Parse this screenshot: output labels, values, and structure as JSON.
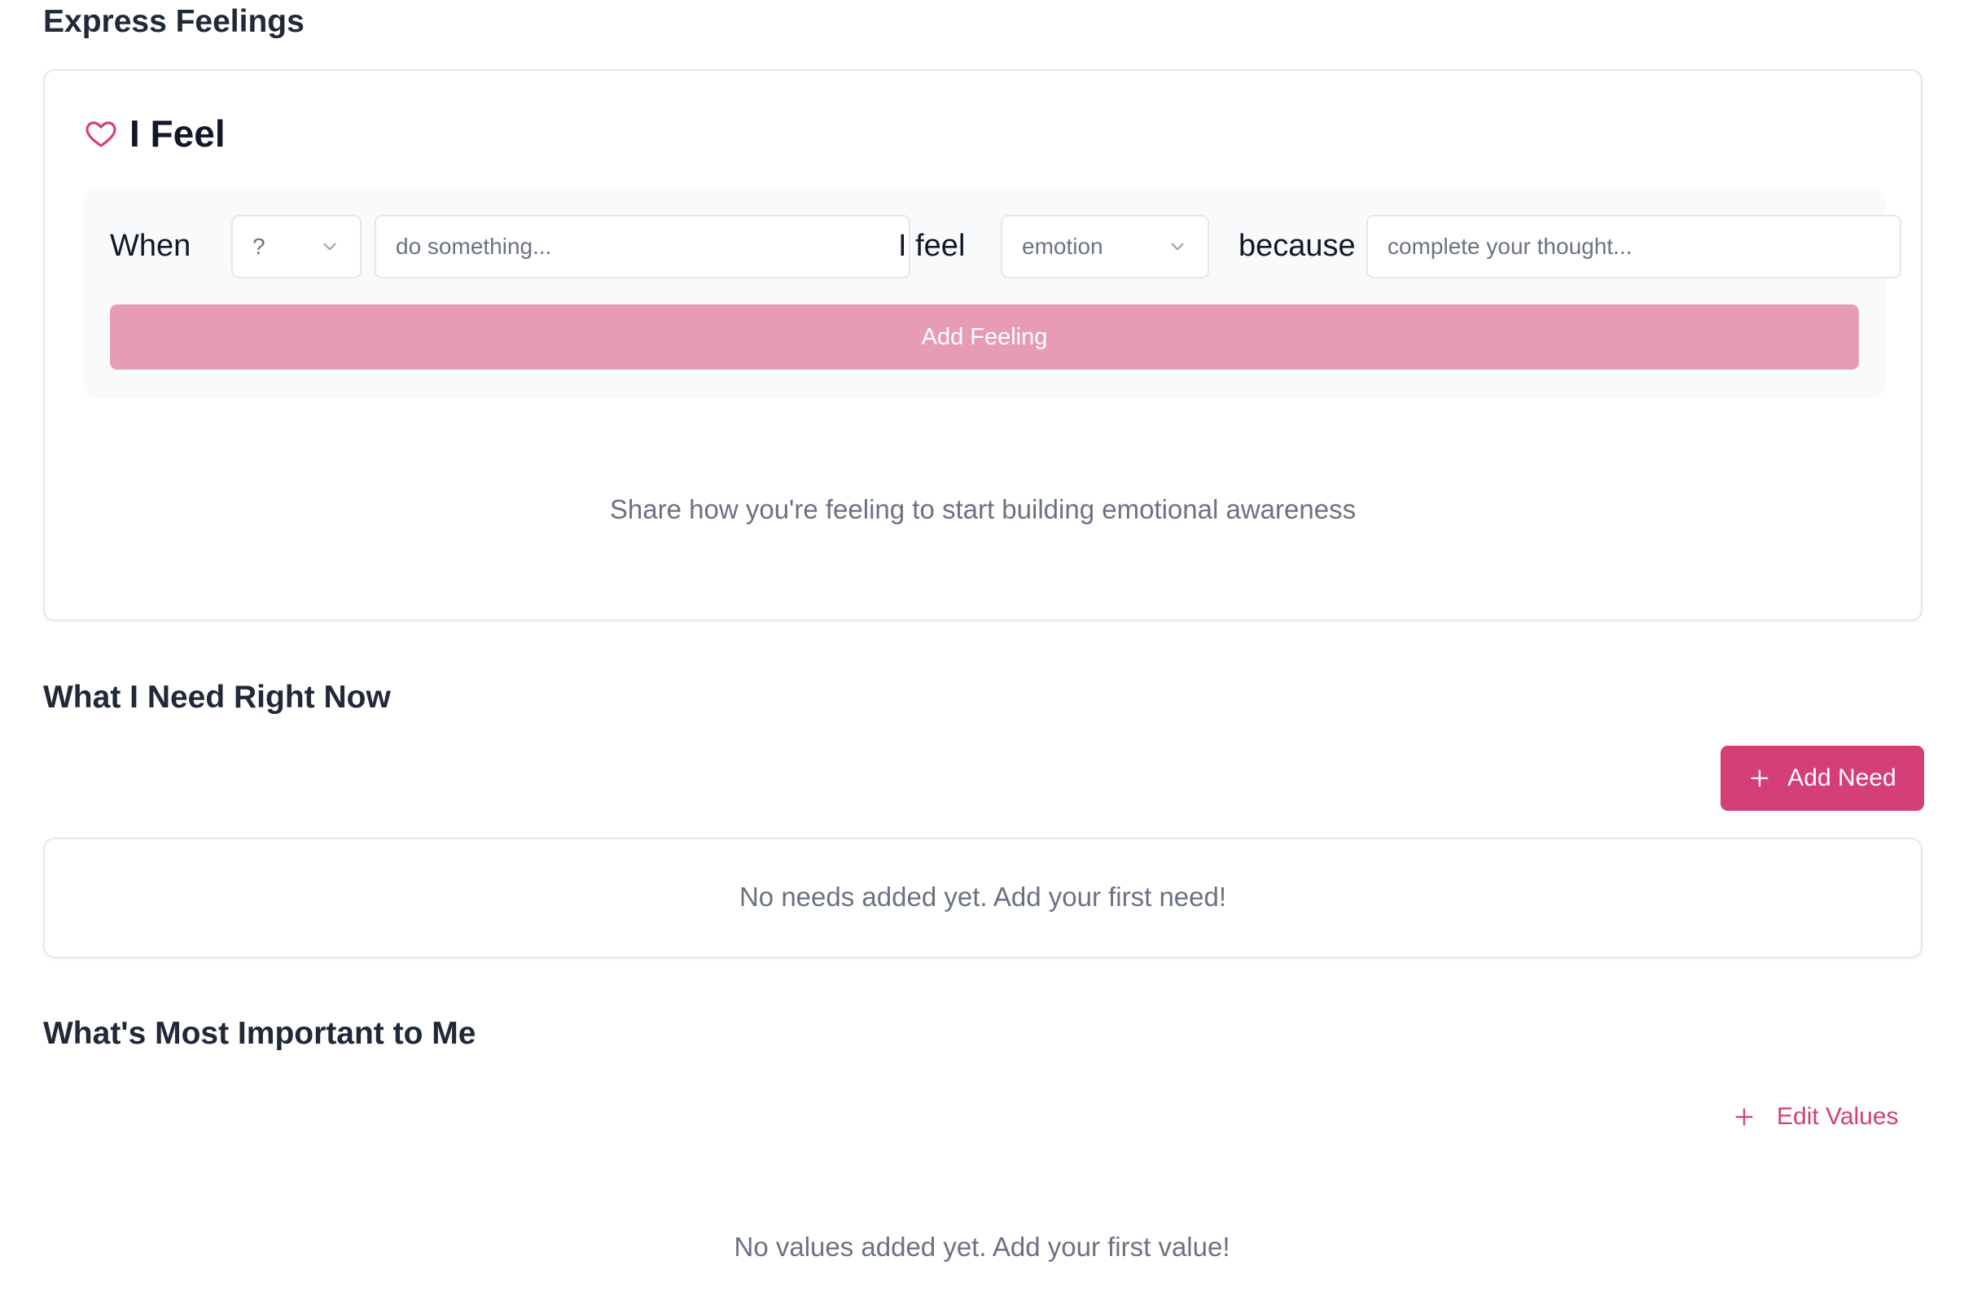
{
  "express_section": {
    "title": "Express Feelings",
    "card_title": "I Feel",
    "icon": "heart-icon",
    "when_word": "When",
    "when_select_value": "?",
    "action_placeholder": "do something...",
    "ifeel_word": "I feel",
    "emotion_select_value": "emotion",
    "because_word": "because",
    "because_placeholder": "complete your thought...",
    "add_button_label": "Add Feeling",
    "empty_message": "Share how you're feeling to start building emotional awareness"
  },
  "needs_section": {
    "title": "What I Need Right Now",
    "add_button_label": "Add Need",
    "empty_message": "No needs added yet. Add your first need!"
  },
  "values_section": {
    "title": "What's Most Important to Me",
    "edit_button_label": "Edit Values",
    "empty_message": "No values added yet. Add your first value!"
  },
  "colors": {
    "accent": "#d43f76",
    "accent_disabled": "#e79bb6",
    "muted_text": "#6b7280",
    "heading_text": "#1f2937"
  }
}
